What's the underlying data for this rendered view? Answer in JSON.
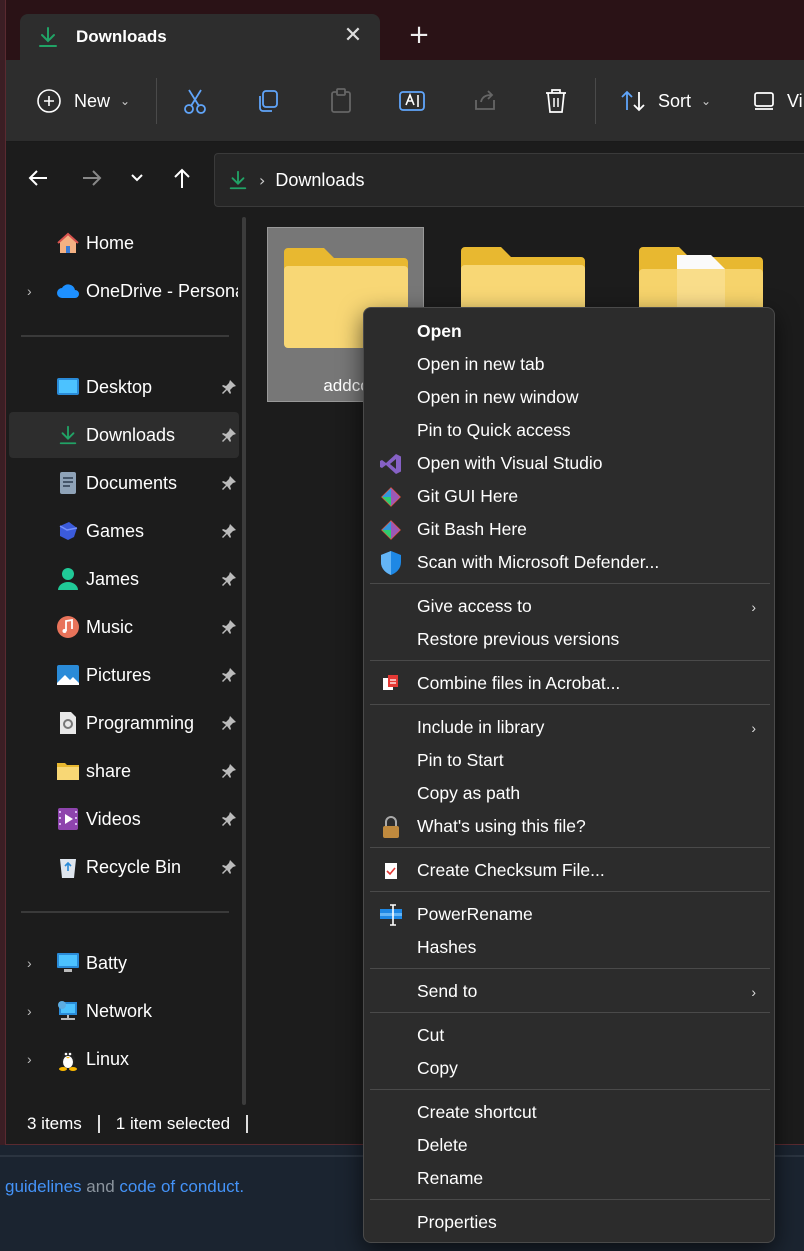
{
  "tab": {
    "title": "Downloads"
  },
  "commandbar": {
    "new_label": "New",
    "sort_label": "Sort",
    "view_label": "Vi"
  },
  "address": {
    "crumb": "Downloads"
  },
  "sidebar": {
    "items": [
      {
        "label": "Home",
        "icon": "home-icon"
      },
      {
        "label": "OneDrive - Persona",
        "icon": "onedrive-icon"
      },
      {
        "label": "Desktop",
        "icon": "desktop-icon"
      },
      {
        "label": "Downloads",
        "icon": "download-icon"
      },
      {
        "label": "Documents",
        "icon": "documents-icon"
      },
      {
        "label": "Games",
        "icon": "games-icon"
      },
      {
        "label": "James",
        "icon": "user-icon"
      },
      {
        "label": "Music",
        "icon": "music-icon"
      },
      {
        "label": "Pictures",
        "icon": "pictures-icon"
      },
      {
        "label": "Programming",
        "icon": "programming-icon"
      },
      {
        "label": "share",
        "icon": "folder-icon"
      },
      {
        "label": "Videos",
        "icon": "videos-icon"
      },
      {
        "label": "Recycle Bin",
        "icon": "recycle-bin-icon"
      },
      {
        "label": "Batty",
        "icon": "computer-icon"
      },
      {
        "label": "Network",
        "icon": "network-icon"
      },
      {
        "label": "Linux",
        "icon": "linux-icon"
      }
    ]
  },
  "content": {
    "tiles": [
      {
        "name": "addco"
      }
    ]
  },
  "status": {
    "count": "3 items",
    "selection": "1 item selected"
  },
  "context_menu": {
    "items": [
      {
        "label": "Open"
      },
      {
        "label": "Open in new tab"
      },
      {
        "label": "Open in new window"
      },
      {
        "label": "Pin to Quick access"
      },
      {
        "label": "Open with Visual Studio",
        "icon": "visual-studio-icon"
      },
      {
        "label": "Git GUI Here",
        "icon": "git-icon"
      },
      {
        "label": "Git Bash Here",
        "icon": "git-icon"
      },
      {
        "label": "Scan with Microsoft Defender...",
        "icon": "defender-shield-icon"
      },
      {
        "label": "Give access to"
      },
      {
        "label": "Restore previous versions"
      },
      {
        "label": "Combine files in Acrobat...",
        "icon": "acrobat-icon"
      },
      {
        "label": "Include in library"
      },
      {
        "label": "Pin to Start"
      },
      {
        "label": "Copy as path"
      },
      {
        "label": "What's using this file?",
        "icon": "lock-icon"
      },
      {
        "label": "Create Checksum File...",
        "icon": "checksum-icon"
      },
      {
        "label": "PowerRename",
        "icon": "powerrename-icon"
      },
      {
        "label": "Hashes"
      },
      {
        "label": "Send to"
      },
      {
        "label": "Cut"
      },
      {
        "label": "Copy"
      },
      {
        "label": "Create shortcut"
      },
      {
        "label": "Delete"
      },
      {
        "label": "Rename"
      },
      {
        "label": "Properties"
      }
    ]
  },
  "background": {
    "link1": "guidelines",
    "text_and": " and ",
    "link2": "code of conduct",
    "text_end": "."
  },
  "colors": {
    "accent_green": "#21a366",
    "folder_yellow": "#f5c542",
    "link_blue": "#4493f8"
  }
}
